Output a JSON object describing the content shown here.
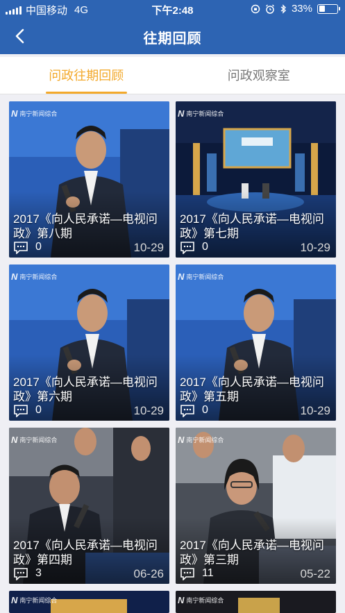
{
  "status_bar": {
    "carrier": "中国移动",
    "network": "4G",
    "time": "下午2:48",
    "battery": "33%",
    "battery_level": 0.33
  },
  "nav": {
    "back_icon": "chevron-left-icon",
    "title": "往期回顾"
  },
  "tabs": [
    {
      "label": "问政往期回顾",
      "active": true
    },
    {
      "label": "问政观察室",
      "active": false
    }
  ],
  "colors": {
    "header": "#2d64b3",
    "accent": "#f3a92b"
  },
  "channel_logo": "南宁新闻综合",
  "episodes": [
    {
      "title": "2017《向人民承诺—电视问政》第八期",
      "comments": "0",
      "date": "10-29",
      "comment_icon": "comment-bubble-icon"
    },
    {
      "title": "2017《向人民承诺—电视问政》第七期",
      "comments": "0",
      "date": "10-29",
      "comment_icon": "comment-bubble-icon"
    },
    {
      "title": "2017《向人民承诺—电视问政》第六期",
      "comments": "0",
      "date": "10-29",
      "comment_icon": "comment-bubble-icon"
    },
    {
      "title": "2017《向人民承诺—电视问政》第五期",
      "comments": "0",
      "date": "10-29",
      "comment_icon": "comment-bubble-icon"
    },
    {
      "title": "2017《向人民承诺—电视问政》第四期",
      "comments": "3",
      "date": "06-26",
      "comment_icon": "comment-bubble-icon"
    },
    {
      "title": "2017《向人民承诺—电视问政》第三期",
      "comments": "11",
      "date": "05-22",
      "comment_icon": "comment-bubble-icon"
    }
  ]
}
